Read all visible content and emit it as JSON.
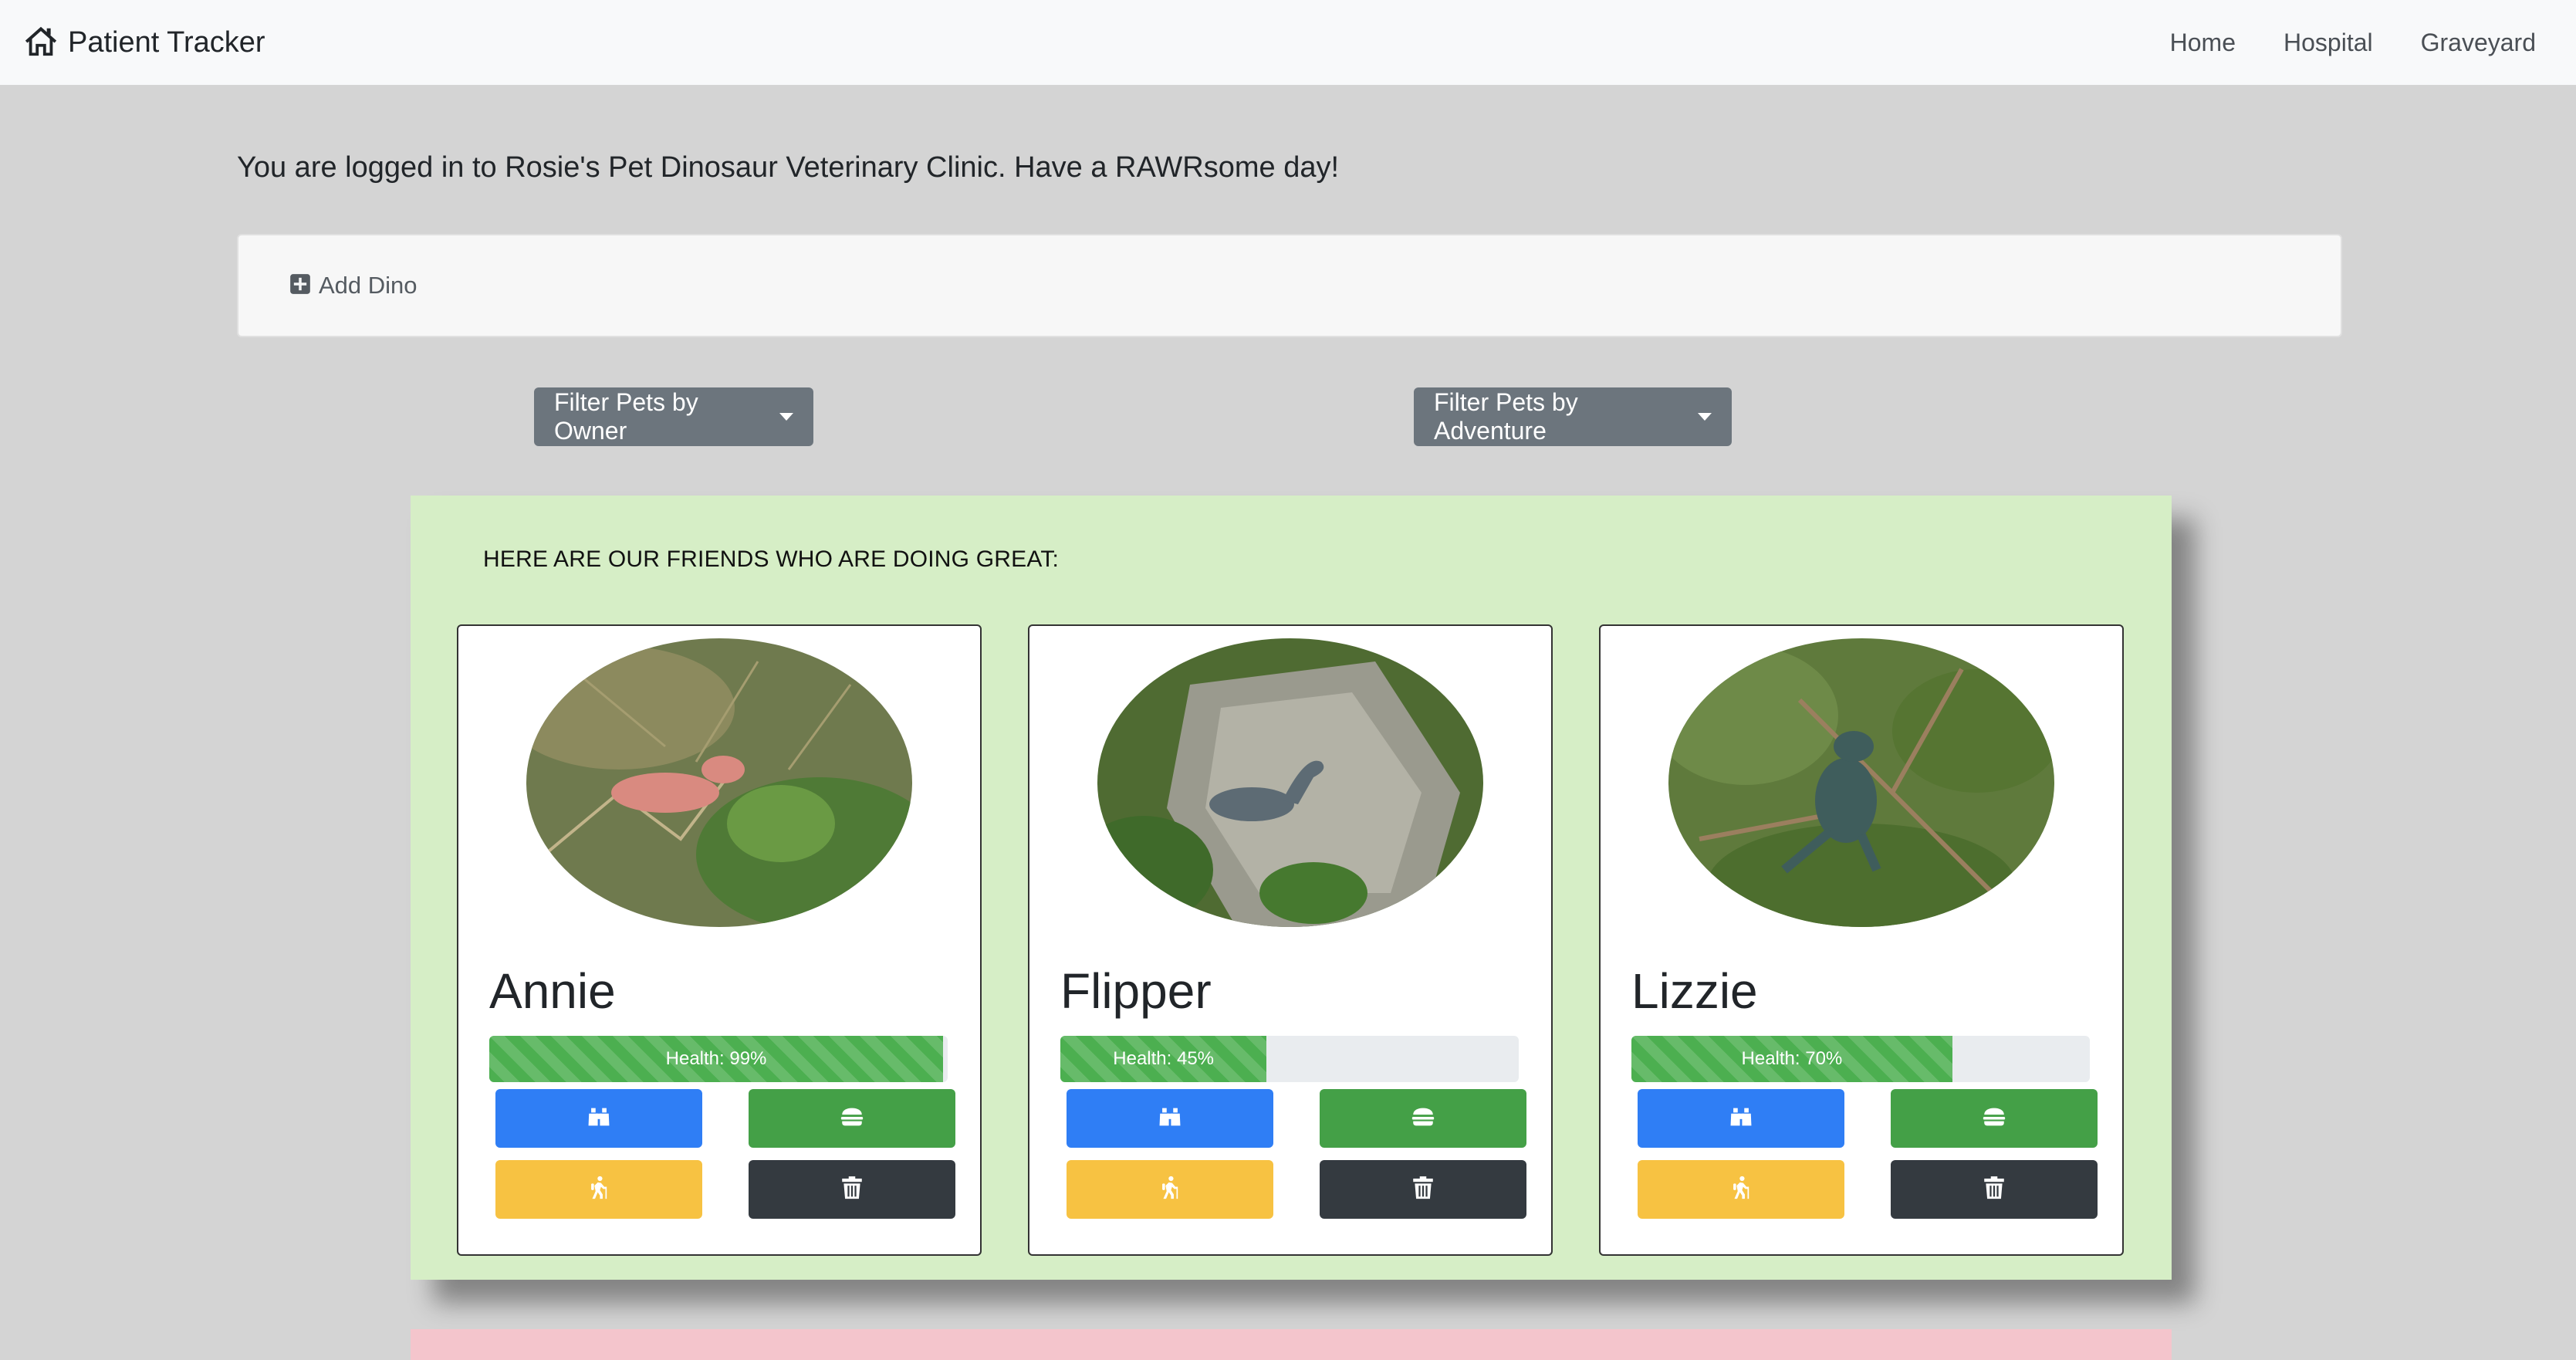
{
  "navbar": {
    "brand": "Patient Tracker",
    "brand_icon": "house-icon",
    "links": [
      "Home",
      "Hospital",
      "Graveyard"
    ]
  },
  "welcome": "You are logged in to Rosie's Pet Dinosaur Veterinary Clinic. Have a RAWRsome day!",
  "add_dino": {
    "label": "Add Dino",
    "icon": "plus-square-icon"
  },
  "filters": {
    "owner": "Filter Pets by Owner",
    "adventure": "Filter Pets by Adventure"
  },
  "great_section": {
    "title": "HERE ARE OUR FRIENDS WHO ARE DOING GREAT:",
    "pets": [
      {
        "name": "Annie",
        "health": 99,
        "health_label": "Health: 99%",
        "toy_color": "#d98a80"
      },
      {
        "name": "Flipper",
        "health": 45,
        "health_label": "Health: 45%",
        "toy_color": "#5d6b74"
      },
      {
        "name": "Lizzie",
        "health": 70,
        "health_label": "Health: 70%",
        "toy_color": "#3f5d5c"
      }
    ],
    "actions": [
      "binoculars-icon",
      "hamburger-icon",
      "hiking-icon",
      "trash-icon"
    ]
  },
  "colors": {
    "background": "#d4d4d4",
    "great_section": "#d6eec6",
    "next_section": "#f4c5cc",
    "explore": "#2f7ef5",
    "feed": "#44a047",
    "adventure": "#f7c242",
    "delete": "#343a40",
    "health": "#4caf50"
  }
}
